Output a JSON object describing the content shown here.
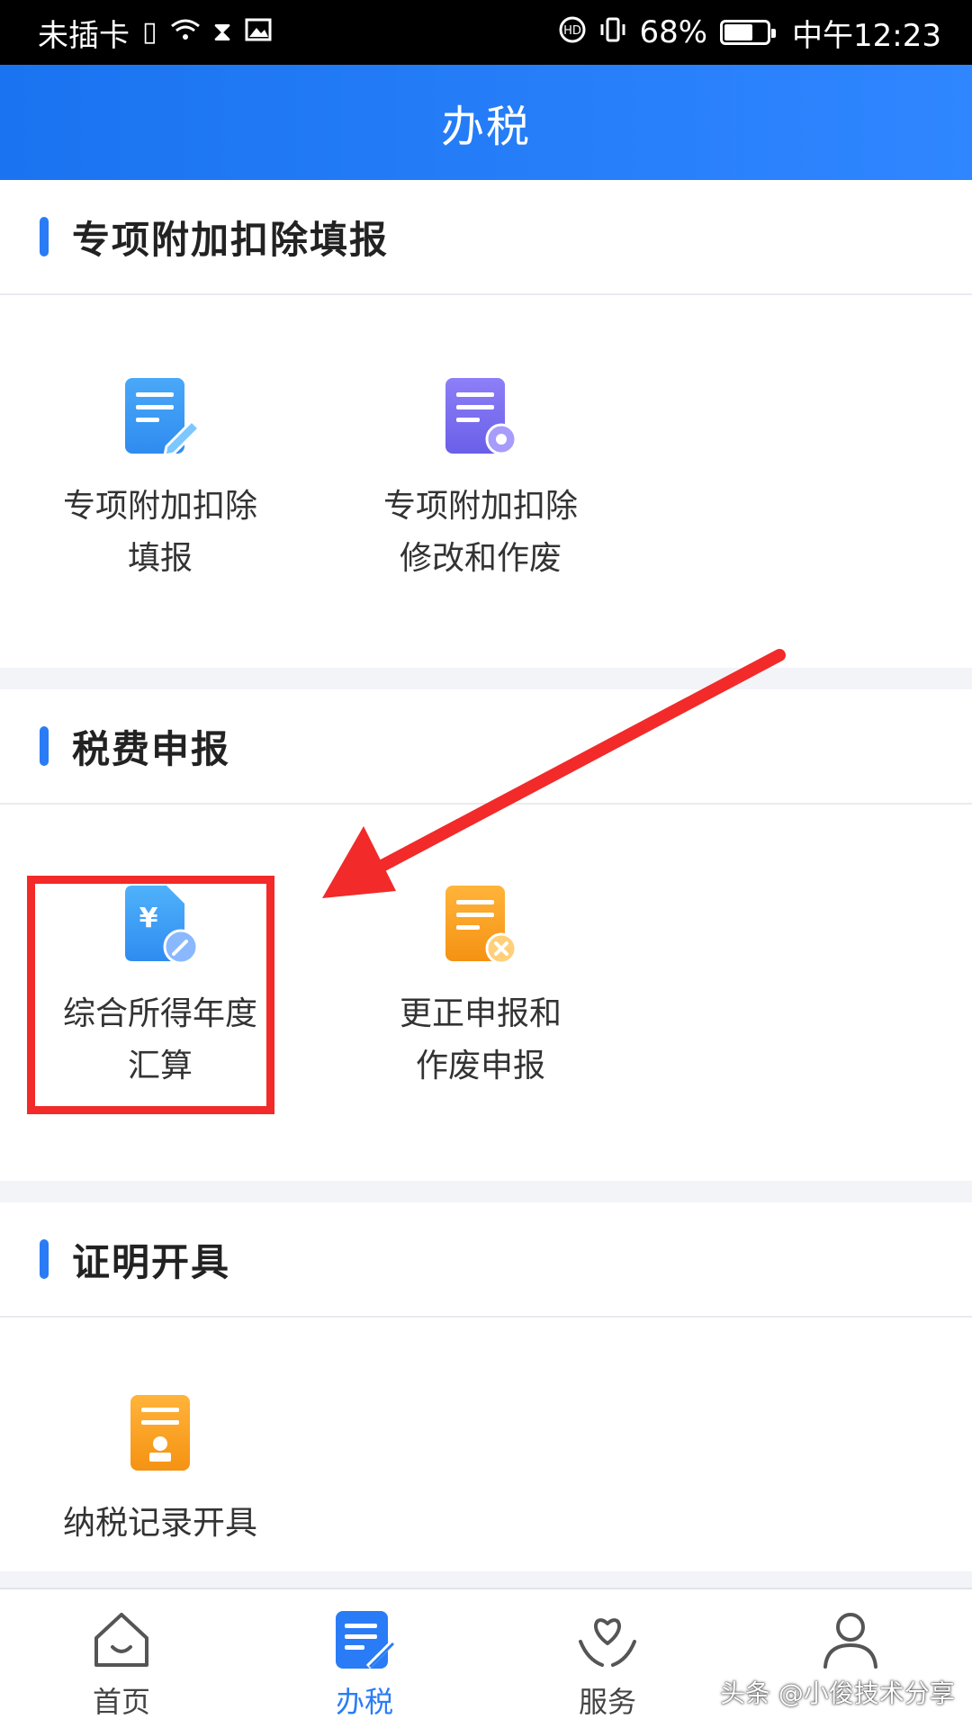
{
  "status_bar": {
    "carrier": "未插卡",
    "battery_percent_text": "68%",
    "battery_level": 0.68,
    "time": "中午12:23",
    "icons": [
      "sim-alert-icon",
      "wifi-icon",
      "hourglass-icon",
      "image-icon",
      "hd-icon",
      "vibrate-icon",
      "battery-icon"
    ]
  },
  "header": {
    "title": "办税"
  },
  "sections": [
    {
      "title": "专项附加扣除填报",
      "items": [
        {
          "label": "专项附加扣除\n填报",
          "icon": "document-edit-icon",
          "color": "#3aa0f5"
        },
        {
          "label": "专项附加扣除\n修改和作废",
          "icon": "document-gear-icon",
          "color": "#7b6ff2"
        }
      ]
    },
    {
      "title": "税费申报",
      "items": [
        {
          "label": "综合所得年度\n汇算",
          "icon": "yuan-document-icon",
          "color": "#3aa0f5"
        },
        {
          "label": "更正申报和\n作废申报",
          "icon": "document-cancel-icon",
          "color": "#f5a623"
        }
      ]
    },
    {
      "title": "证明开具",
      "items": [
        {
          "label": "纳税记录开具",
          "icon": "document-stamp-icon",
          "color": "#f5a623"
        }
      ]
    }
  ],
  "tabs": [
    {
      "label": "首页",
      "icon": "home-icon",
      "active": false
    },
    {
      "label": "办税",
      "icon": "tax-edit-icon",
      "active": true
    },
    {
      "label": "服务",
      "icon": "heart-hands-icon",
      "active": false
    },
    {
      "label": "",
      "icon": "user-icon",
      "active": false
    }
  ],
  "watermark": "头条 @小俊技术分享",
  "colors": {
    "primary": "#2a7cf6",
    "highlight": "#f22a2a"
  }
}
